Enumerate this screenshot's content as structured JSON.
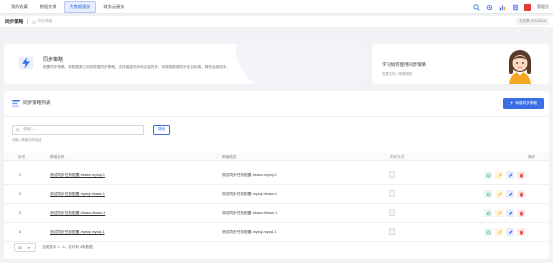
{
  "nav": {
    "tabs": [
      {
        "label": "我的收藏"
      },
      {
        "label": "数据交换"
      },
      {
        "label": "大数据服务"
      },
      {
        "label": "政务云服务"
      }
    ],
    "user_name": "管理员"
  },
  "breadcrumb": {
    "title": "同步策略",
    "path": "同步策略",
    "date": "今天是 2021/8/26"
  },
  "banner": {
    "title": "同步策略",
    "description": "配置同步策略，将数据源之间的数据同步策略，支持增量同步和全量同步，将源端数据同步至目标端，降低运维成本。"
  },
  "guide": {
    "title": "学习如何使用同步策略",
    "subtitle": "查看文档 / 观看视频"
  },
  "panel": {
    "title": "同步策略列表",
    "add_button": "新增同步策略"
  },
  "search": {
    "placeholder": "请输入...",
    "button": "搜索",
    "hint": "请输入策略名称/描述"
  },
  "table": {
    "columns": [
      "序号",
      "策略名称",
      "策略描述",
      "同步方式",
      "操作"
    ],
    "rows": [
      {
        "index": "1",
        "name": "测试同步任务配置-hbase-mysql-1",
        "desc": "测试同步任务配置-hbase-mysql-1"
      },
      {
        "index": "2",
        "name": "测试同步任务配置-mysql-hbase-1",
        "desc": "测试同步任务配置-mysql-hbase-1"
      },
      {
        "index": "3",
        "name": "测试同步任务配置-hbase-hbase-1",
        "desc": "测试同步任务配置-hbase-hbase-1"
      },
      {
        "index": "4",
        "name": "测试同步任务配置-mysql-mysql-1",
        "desc": "测试同步任务配置-mysql-mysql-1"
      }
    ]
  },
  "pager": {
    "page_size": "10",
    "summary": "当前显示 1 - 4，总共有 4条数据"
  },
  "colors": {
    "primary": "#3b6ee6",
    "danger": "#e53935"
  }
}
